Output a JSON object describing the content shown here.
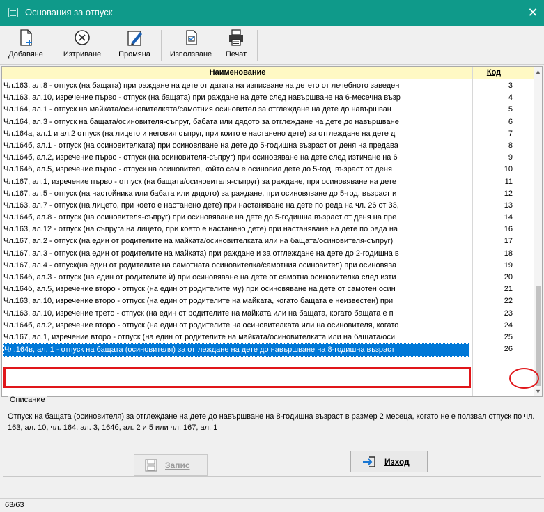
{
  "window": {
    "title": "Основания за отпуск",
    "close_glyph": "✕"
  },
  "toolbar": {
    "add_label": "Добавяне",
    "delete_label": "Изтриване",
    "edit_label": "Промяна",
    "use_label": "Използване",
    "print_label": "Печат"
  },
  "grid": {
    "header_name": "Наименование",
    "header_code": "Код",
    "rows": [
      {
        "name": "Чл.163, ал.8 - отпуск (на бащата) при раждане на дете от датата на изписване на детето от лечебното заведен",
        "code": "3"
      },
      {
        "name": "Чл.163, ал.10, изречение първо - отпуск (на бащата) при раждане на дете след навършване на 6-месечна възр",
        "code": "4"
      },
      {
        "name": "Чл.164, ал.1 - отпуск на майката/осиновителката/самотния осиновител за отглеждане на дете до навършван",
        "code": "5"
      },
      {
        "name": "Чл.164, ал.3 - отпуск на бащата/осиновителя-съпруг, бабата или дядото за отглеждане на дете до навършване",
        "code": "6"
      },
      {
        "name": "Чл.164а, ал.1 и ал.2 отпуск (на лицето и неговия съпруг, при които е настанено дете) за отглеждане на дете д",
        "code": "7"
      },
      {
        "name": "Чл.164б, ал.1 - отпуск (на осиновителката) при осиновяване на дете до 5-годишна възраст от деня на предава",
        "code": "8"
      },
      {
        "name": "Чл.164б, ал.2, изречение първо - отпуск (на осиновителя-съпруг) при осиновяване на дете след изтичане на 6",
        "code": "9"
      },
      {
        "name": "Чл.164б, ал.5, изречение първо - отпуск на осиновител, който сам е осиновил дете до 5-год. възраст от деня",
        "code": "10"
      },
      {
        "name": "Чл.167, ал.1, изречение първо - отпуск (на бащата/осиновителя-съпруг) за раждане, при осиновяване на дете",
        "code": "11"
      },
      {
        "name": "Чл.167, ал.5 - отпуск (на настойника или бабата или дядото) за раждане, при осиновяване до 5-год. възраст и",
        "code": "12"
      },
      {
        "name": "Чл.163, ал.7 - отпуск (на лицето, при което е настанено дете) при настаняване на дете по реда на чл. 26 от 33,",
        "code": "13"
      },
      {
        "name": "Чл.164б, ал.8 - отпуск (на осиновителя-съпруг) при осиновяване на дете до 5-годишна възраст от деня на пре",
        "code": "14"
      },
      {
        "name": "Чл.163, ал.12 - отпуск (на съпруга на лицето, при което е настанено дете) при настаняване на дете по реда на",
        "code": "16"
      },
      {
        "name": "Чл.167, ал.2 - отпуск (на един от родителите на майката/осиновителката или на бащата/осиновителя-съпруг)",
        "code": "17"
      },
      {
        "name": "Чл.167, ал.3 - отпуск (на един от родителите на майката) при раждане и за отглеждане на дете до 2-годишна в",
        "code": "18"
      },
      {
        "name": "Чл.167, ал.4 - отпуск(на един от родителите на самотната осиновителка/самотния осиновител) при осиновява",
        "code": "19"
      },
      {
        "name": "Чл.164б, ал.3 - отпуск (на един от родителите ѝ) при осиновяване на дете от самотна осиновителка след изти",
        "code": "20"
      },
      {
        "name": "Чл.164б, ал.5, изречение второ - отпуск (на един от родителите му) при осиновяване на дете от самотен осин",
        "code": "21"
      },
      {
        "name": "Чл.163, ал.10, изречение второ - отпуск (на един от родителите на майката, когато бащата е неизвестен) при",
        "code": "22"
      },
      {
        "name": "Чл.163, ал.10, изречение трето - отпуск (на един от родителите на майката или на бащата, когато бащата е п",
        "code": "23"
      },
      {
        "name": "Чл.164б, ал.2, изречение второ - отпуск (на един от родителите на осиновителката или на осиновителя, когато",
        "code": "24"
      },
      {
        "name": "Чл.167, ал.1, изречение второ - отпуск (на един от родителите на майката/осиновителката или на бащата/оси",
        "code": "25"
      },
      {
        "name": "Чл.164в, ал. 1 - отпуск на бащата (осиновителя) за отглеждане на дете до навършване на 8-годишна възраст",
        "code": "26",
        "selected": true
      }
    ]
  },
  "description": {
    "legend": "Описание",
    "text": "Отпуск на бащата (осиновителя) за отглеждане на дете до навършване на 8-годишна възраст в размер 2 месеца, когато не е ползвал отпуск по чл. 163, ал. 10, чл. 164, ал. 3, 164б, ал. 2 и 5 или чл. 167, ал. 1"
  },
  "buttons": {
    "save_label": "Запис",
    "exit_label": "Изход"
  },
  "status": {
    "record_position": "63/63"
  },
  "colors": {
    "titlebar": "#0f9a8a",
    "header_bg": "#fff9c4",
    "selection": "#0078d7",
    "highlight": "#e0161a"
  }
}
